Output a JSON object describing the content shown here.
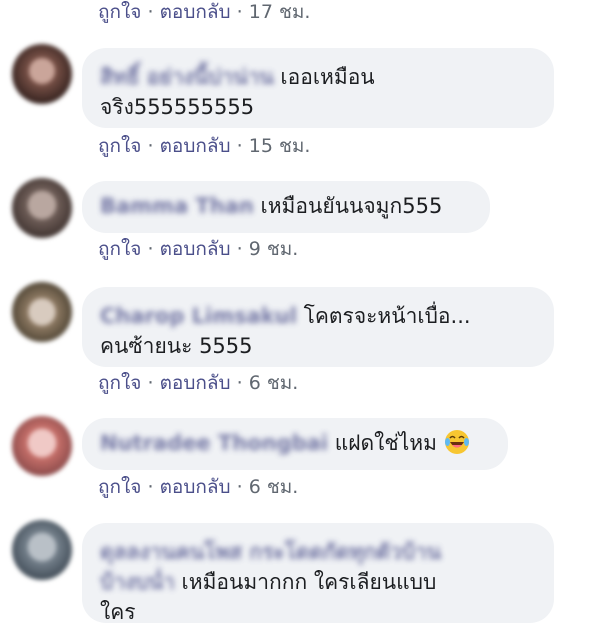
{
  "action_like": "ถูกใจ",
  "action_sep": "·",
  "action_reply": "ตอบกลับ",
  "comments": [
    {
      "time": "17 ชม."
    },
    {
      "author": "สิทธิ์ อย่างนี้บ่าน่าน",
      "text_line1": "เออเหมือน",
      "text_line2": "จริง555555555",
      "time": "15 ชม."
    },
    {
      "author": "Bamma Than",
      "text": "เหมือนยันนจมูก555",
      "time": "9 ชม."
    },
    {
      "author": "Charop Limsakul",
      "text_line1": "โคตรจะหน้าเบื่อ...",
      "text_line2": "คนซ้ายนะ 5555",
      "time": "6 ชม."
    },
    {
      "author": "Nutradee Thongbai",
      "text": "แฝดใช่ไหม",
      "emoji": "laughing-crying-face",
      "time": "6 ชม."
    },
    {
      "author_line1": "ดุลลงานคนโพส กระโดดกัดทุกตัวบ้าน",
      "author_line2": "บ้างบน่ำ",
      "text_line1": "เหมือนมากกก ใครเลียนแบบ",
      "text_line2": "ใคร"
    }
  ],
  "colors": {
    "link": "#4b4f8a",
    "meta": "#606770",
    "bubble": "#f0f2f5",
    "text": "#1c1e21"
  }
}
